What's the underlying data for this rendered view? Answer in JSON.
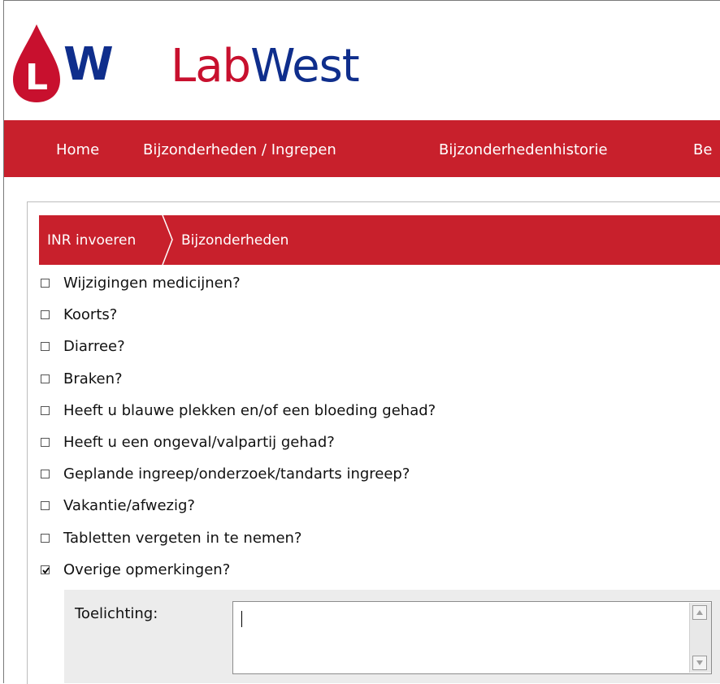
{
  "brand": {
    "logo_letters": "LW",
    "name_part1": "Lab",
    "name_part2": "West",
    "logo_mark_letter": "L"
  },
  "colors": {
    "brand_red": "#c8202c",
    "brand_blue": "#0f2e8c"
  },
  "nav": {
    "items": [
      "Home",
      "Bijzonderheden / Ingrepen",
      "Bijzonderhedenhistorie",
      "Be"
    ]
  },
  "breadcrumb": {
    "step1": "INR invoeren",
    "step2": "Bijzonderheden"
  },
  "options": [
    {
      "label": "Wijzigingen medicijnen?",
      "checked": false
    },
    {
      "label": "Koorts?",
      "checked": false
    },
    {
      "label": "Diarree?",
      "checked": false
    },
    {
      "label": "Braken?",
      "checked": false
    },
    {
      "label": "Heeft u blauwe plekken en/of een bloeding gehad?",
      "checked": false
    },
    {
      "label": "Heeft u een ongeval/valpartij gehad?",
      "checked": false
    },
    {
      "label": "Geplande ingreep/onderzoek/tandarts ingreep?",
      "checked": false
    },
    {
      "label": "Vakantie/afwezig?",
      "checked": false
    },
    {
      "label": "Tabletten vergeten in te nemen?",
      "checked": false
    },
    {
      "label": "Overige opmerkingen?",
      "checked": true
    }
  ],
  "toelichting": {
    "label": "Toelichting:",
    "value": ""
  }
}
